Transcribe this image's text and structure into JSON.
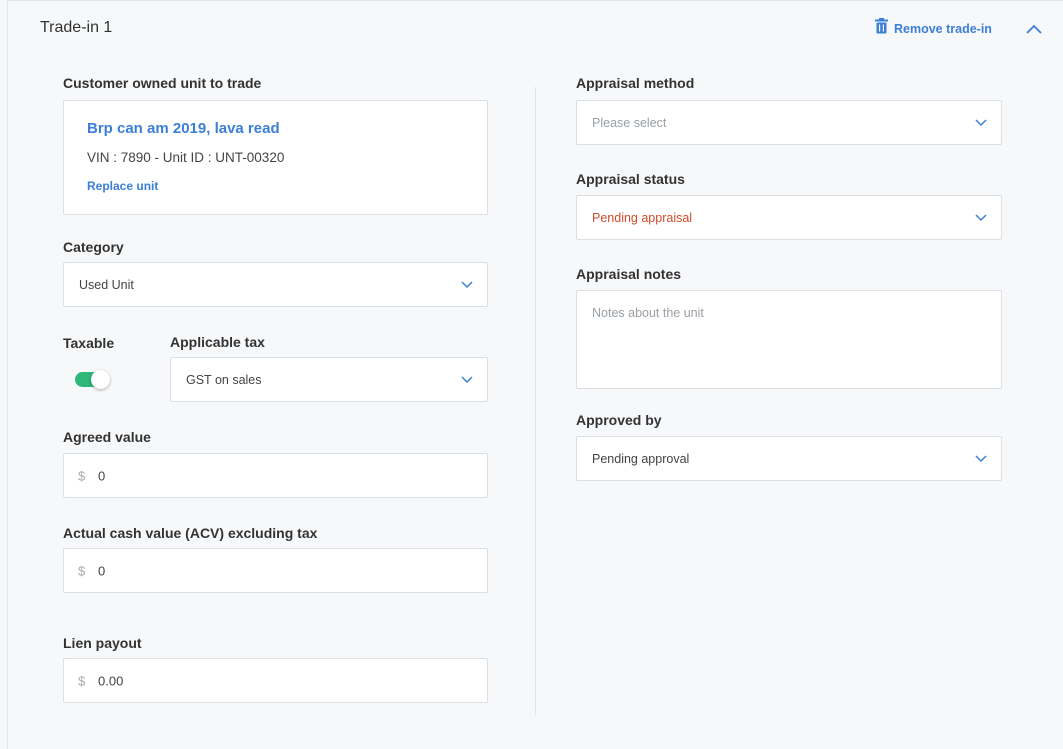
{
  "header": {
    "title": "Trade-in 1",
    "remove_label": "Remove trade-in"
  },
  "unit": {
    "label": "Customer owned unit to trade",
    "name": "Brp can am 2019, lava read",
    "vin_line": "VIN : 7890 - Unit ID : UNT-00320",
    "replace_label": "Replace unit"
  },
  "category": {
    "label": "Category",
    "value": "Used Unit"
  },
  "taxable": {
    "label": "Taxable",
    "on": true
  },
  "tax": {
    "label": "Applicable tax",
    "value": "GST on sales"
  },
  "agreed": {
    "label": "Agreed value",
    "currency": "$",
    "value": "0"
  },
  "acv": {
    "label": "Actual cash value (ACV) excluding tax",
    "currency": "$",
    "value": "0"
  },
  "lien": {
    "label": "Lien payout",
    "currency": "$",
    "value": "0.00"
  },
  "appraisal_method": {
    "label": "Appraisal method",
    "placeholder": "Please select"
  },
  "appraisal_status": {
    "label": "Appraisal status",
    "value": "Pending appraisal"
  },
  "appraisal_notes": {
    "label": "Appraisal notes",
    "placeholder": "Notes about the unit"
  },
  "approved_by": {
    "label": "Approved by",
    "value": "Pending approval"
  },
  "colors": {
    "accent": "#3b7fd6",
    "toggle_on": "#2fb77a",
    "pending": "#d14b2c"
  }
}
